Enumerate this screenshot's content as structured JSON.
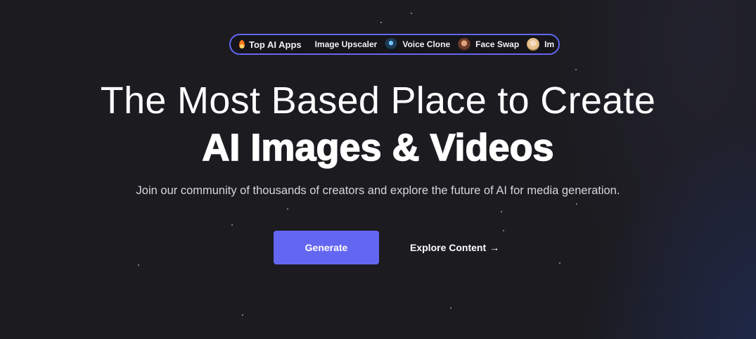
{
  "top_apps": {
    "lead_label": "Top AI Apps",
    "items": [
      {
        "label": "Image Upscaler",
        "icon": "none"
      },
      {
        "label": "Voice Clone",
        "icon": "avatar-voice"
      },
      {
        "label": "Face Swap",
        "icon": "avatar-face"
      },
      {
        "label": "Im",
        "icon": "avatar-woman"
      }
    ]
  },
  "hero": {
    "title_line1": "The Most Based Place to Create",
    "title_line2": "AI Images & Videos",
    "subtitle": "Join our community of thousands of creators and explore the future of AI for media generation."
  },
  "actions": {
    "generate_label": "Generate",
    "explore_label": "Explore Content",
    "explore_arrow": "→"
  },
  "colors": {
    "accent": "#6366f1",
    "background": "#1c1b20"
  }
}
